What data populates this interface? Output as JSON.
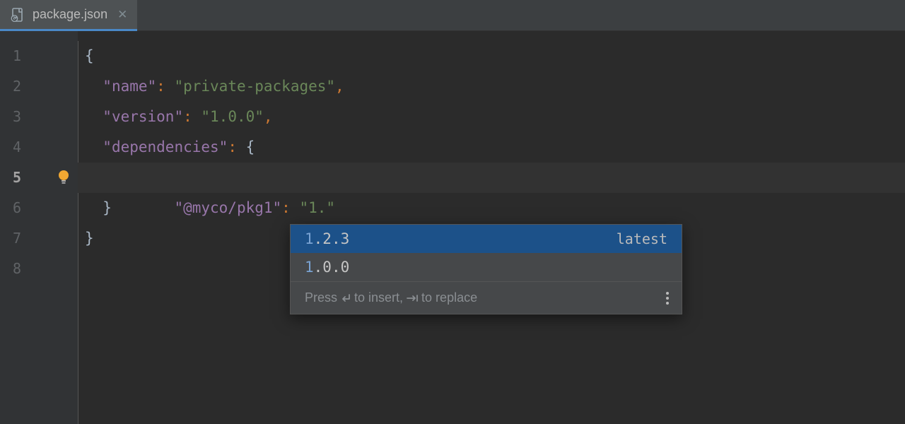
{
  "tab": {
    "filename": "package.json"
  },
  "gutter": {
    "lines": [
      "1",
      "2",
      "3",
      "4",
      "5",
      "6",
      "7",
      "8"
    ]
  },
  "code": {
    "line1_brace": "{",
    "line2_key": "\"name\"",
    "line2_colon": ":",
    "line2_val": " \"private-packages\"",
    "line2_comma": ",",
    "line3_key": "\"version\"",
    "line3_colon": ":",
    "line3_val": " \"1.0.0\"",
    "line3_comma": ",",
    "line4_key": "\"dependencies\"",
    "line4_colon": ":",
    "line4_brace": " {",
    "line5_key": "\"@myco/pkg1\"",
    "line5_colon": ":",
    "line5_val": " \"1.\"",
    "line6_brace": "}",
    "line7_brace": "}"
  },
  "popup": {
    "item1_first": "1",
    "item1_rest": ".2.3",
    "item1_label": "latest",
    "item2_first": "1",
    "item2_rest": ".0.0",
    "footer_press": "Press ",
    "footer_insert": " to insert, ",
    "footer_replace": " to replace"
  }
}
